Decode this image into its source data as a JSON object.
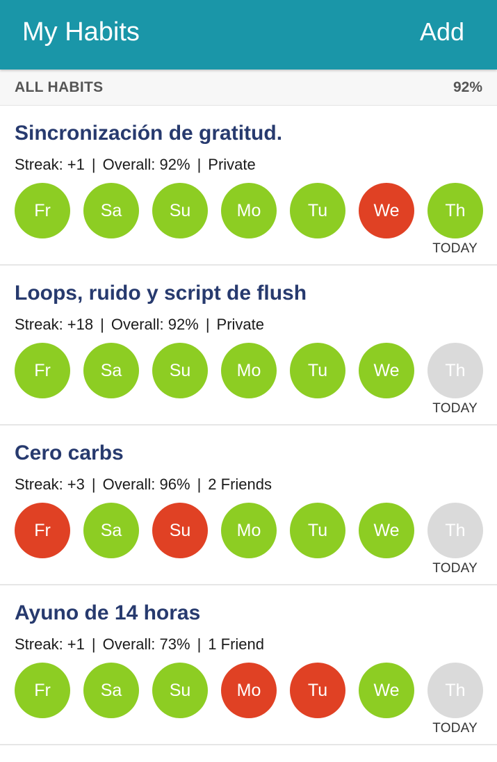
{
  "header": {
    "title": "My Habits",
    "add_label": "Add"
  },
  "summary": {
    "label": "ALL HABITS",
    "value": "92%"
  },
  "colors": {
    "header_bg": "#1a96a8",
    "done": "#8dcd23",
    "missed": "#e04124",
    "pending": "#dadada",
    "title_text": "#273a6e"
  },
  "habits": [
    {
      "title": "Sincronización de gratitud.",
      "streak": "Streak: +1",
      "overall": "Overall: 92%",
      "visibility": "Private",
      "today_label": "TODAY",
      "days": [
        {
          "label": "Fr",
          "status": "done"
        },
        {
          "label": "Sa",
          "status": "done"
        },
        {
          "label": "Su",
          "status": "done"
        },
        {
          "label": "Mo",
          "status": "done"
        },
        {
          "label": "Tu",
          "status": "done"
        },
        {
          "label": "We",
          "status": "missed"
        },
        {
          "label": "Th",
          "status": "done"
        }
      ]
    },
    {
      "title": "Loops, ruido y script de flush",
      "streak": "Streak: +18",
      "overall": "Overall: 92%",
      "visibility": "Private",
      "today_label": "TODAY",
      "days": [
        {
          "label": "Fr",
          "status": "done"
        },
        {
          "label": "Sa",
          "status": "done"
        },
        {
          "label": "Su",
          "status": "done"
        },
        {
          "label": "Mo",
          "status": "done"
        },
        {
          "label": "Tu",
          "status": "done"
        },
        {
          "label": "We",
          "status": "done"
        },
        {
          "label": "Th",
          "status": "pending"
        }
      ]
    },
    {
      "title": "Cero carbs",
      "streak": "Streak: +3",
      "overall": "Overall: 96%",
      "visibility": "2 Friends",
      "today_label": "TODAY",
      "days": [
        {
          "label": "Fr",
          "status": "missed"
        },
        {
          "label": "Sa",
          "status": "done"
        },
        {
          "label": "Su",
          "status": "missed"
        },
        {
          "label": "Mo",
          "status": "done"
        },
        {
          "label": "Tu",
          "status": "done"
        },
        {
          "label": "We",
          "status": "done"
        },
        {
          "label": "Th",
          "status": "pending"
        }
      ]
    },
    {
      "title": "Ayuno de 14 horas",
      "streak": "Streak: +1",
      "overall": "Overall: 73%",
      "visibility": "1 Friend",
      "today_label": "TODAY",
      "days": [
        {
          "label": "Fr",
          "status": "done"
        },
        {
          "label": "Sa",
          "status": "done"
        },
        {
          "label": "Su",
          "status": "done"
        },
        {
          "label": "Mo",
          "status": "missed"
        },
        {
          "label": "Tu",
          "status": "missed"
        },
        {
          "label": "We",
          "status": "done"
        },
        {
          "label": "Th",
          "status": "pending"
        }
      ]
    }
  ]
}
